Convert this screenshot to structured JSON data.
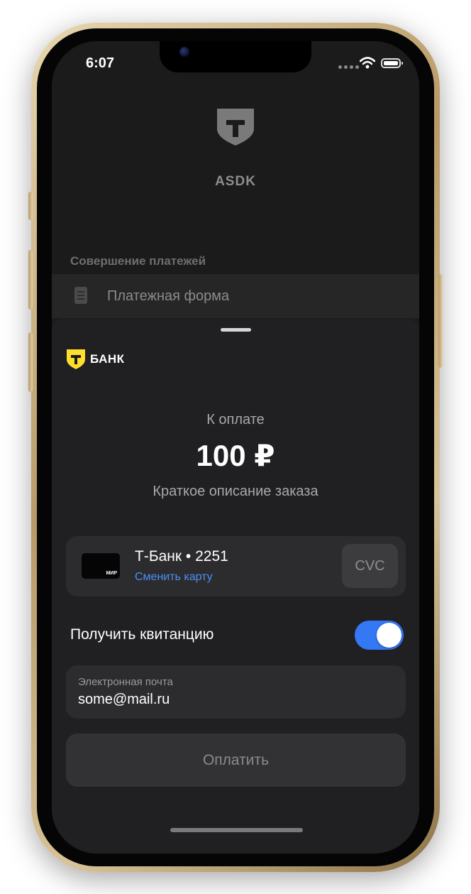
{
  "status_bar": {
    "time": "6:07"
  },
  "app": {
    "name": "ASDK",
    "section_title": "Совершение платежей",
    "menu_item": "Платежная форма"
  },
  "sheet": {
    "brand": "БАНК",
    "pay_label": "К оплате",
    "amount": "100 ₽",
    "order_description": "Краткое описание заказа",
    "card": {
      "name": "Т-Банк • 2251",
      "change_label": "Сменить карту",
      "system": "МИР",
      "cvc_placeholder": "CVC"
    },
    "receipt": {
      "label": "Получить квитанцию",
      "enabled": true
    },
    "email": {
      "label": "Электронная почта",
      "value": "some@mail.ru"
    },
    "pay_button": "Оплатить"
  },
  "colors": {
    "accent": "#3478f6",
    "link": "#4b8ff5",
    "brand_yellow": "#ffdd2d",
    "background": "#202022"
  }
}
